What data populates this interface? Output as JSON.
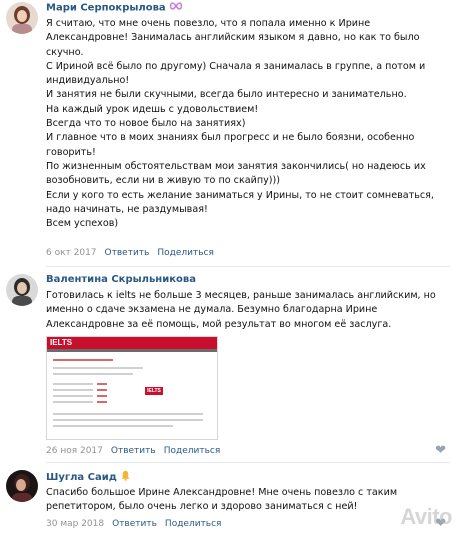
{
  "comments": [
    {
      "author": "Мари Серпокрылова",
      "badge_icon": "infinity-icon",
      "text": "Я считаю, что мне очень повезло, что я попала именно к Ирине Александровне! Занималась английским языком я давно, но как то было скучно.\nС Ириной всё было по другому) Сначала я занималась в группе, а потом и индивидуально!\nИ занятия не были скучными, всегда было интересно и занимательно.\nНа каждый урок идешь с удовольствием!\nВсегда что то новое было на занятиях)\nИ главное что в моих знаниях был прогресс и не было боязни, особенно говорить!\nПо жизненным обстоятельствам мои занятия закончились( но надеюсь их возобновить, если ни в живую то по скайпу)))\nЕсли у кого то есть желание заниматься у Ирины, то не стоит сомневаться, надо начинать, не раздумывая!\nВсем успехов)",
      "date": "6 окт 2017",
      "reply": "Ответить",
      "share": "Поделиться"
    },
    {
      "author": "Валентина Скрыльникова",
      "text": "Готовилась к ielts не больше 3 месяцев, раньше занималась английским, но именно о сдаче экзамена не думала. Безумно благодарна Ирине Александровне за её помощь, мой результат во многом её заслуга.",
      "attachment_brand": "IELTS",
      "date": "26 ноя 2017",
      "reply": "Ответить",
      "share": "Поделиться",
      "like_icon": "heart-icon"
    },
    {
      "author": "Шугла Саид",
      "badge_icon": "bell-icon",
      "text": "Спасибо большое Ирине Александровне! Мне очень повезло с таким репетитором, было очень легко и здорово заниматься с ней!",
      "date": "30 мар 2018",
      "reply": "Ответить",
      "share": "Поделиться",
      "like_icon": "heart-icon"
    }
  ],
  "watermark": "Avito",
  "colors": {
    "link": "#2a5885",
    "meta": "#939393",
    "ielts_red": "#c8102e"
  }
}
